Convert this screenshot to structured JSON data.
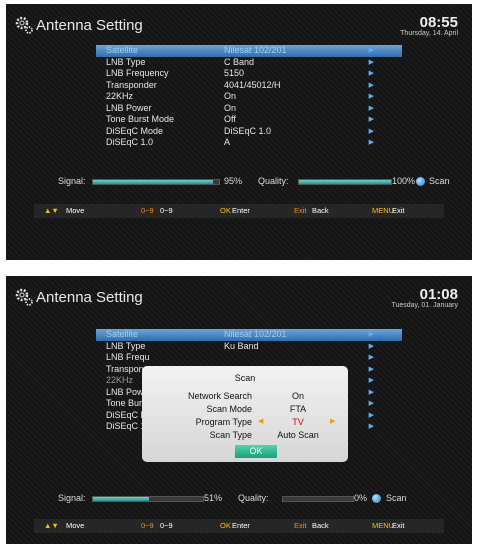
{
  "screens": [
    {
      "title": "Antenna Setting",
      "time": "08:55",
      "date": "Thursday, 14. April",
      "rows": [
        {
          "label": "Satellite",
          "value": "Nilesat 102/201"
        },
        {
          "label": "LNB Type",
          "value": "C Band"
        },
        {
          "label": "LNB Frequency",
          "value": "5150"
        },
        {
          "label": "Transponder",
          "value": "4041/45012/H"
        },
        {
          "label": "22KHz",
          "value": "On"
        },
        {
          "label": "LNB Power",
          "value": "On"
        },
        {
          "label": "Tone Burst Mode",
          "value": "Off"
        },
        {
          "label": "DiSEqC Mode",
          "value": "DiSEqC 1.0"
        },
        {
          "label": "DiSEqC 1.0",
          "value": "A"
        }
      ],
      "signal_label": "Signal:",
      "signal_pct": "95%",
      "signal_level": 0.95,
      "quality_label": "Quality:",
      "quality_pct": "100%",
      "quality_level": 1.0,
      "scan_label": "Scan",
      "footer": {
        "move": "Move",
        "num": "0~9",
        "num_desc": "0~9",
        "ok": "OK",
        "ok_desc": "Enter",
        "exit": "Exit",
        "exit_desc": "Back",
        "menu": "MENU",
        "menu_desc": "Exit"
      }
    },
    {
      "title": "Antenna Setting",
      "time": "01:08",
      "date": "Tuesday, 01. January",
      "rows": [
        {
          "label": "Satellite",
          "value": "Nilesat 102/201"
        },
        {
          "label": "LNB Type",
          "value": "Ku Band"
        },
        {
          "label": "LNB Frequ",
          "value": ""
        },
        {
          "label": "Transponc",
          "value": ""
        },
        {
          "label": "22KHz",
          "value": ""
        },
        {
          "label": "LNB Powe",
          "value": ""
        },
        {
          "label": "Tone Burs",
          "value": ""
        },
        {
          "label": "DiSEqC M",
          "value": ""
        },
        {
          "label": "DiSEqC 1",
          "value": ""
        }
      ],
      "signal_label": "Signal:",
      "signal_pct": "51%",
      "signal_level": 0.51,
      "quality_label": "Quality:",
      "quality_pct": "0%",
      "quality_level": 0,
      "scan_label": "Scan",
      "footer": {
        "move": "Move",
        "num": "0~9",
        "num_desc": "0~9",
        "ok": "OK",
        "ok_desc": "Enter",
        "exit": "Exit",
        "exit_desc": "Back",
        "menu": "MENU",
        "menu_desc": "Exit"
      },
      "dialog": {
        "title": "Scan",
        "items": [
          {
            "label": "Network Search",
            "value": "On"
          },
          {
            "label": "Scan Mode",
            "value": "FTA"
          },
          {
            "label": "Program Type",
            "value": "TV"
          },
          {
            "label": "Scan Type",
            "value": "Auto Scan"
          }
        ],
        "ok": "OK"
      }
    }
  ]
}
